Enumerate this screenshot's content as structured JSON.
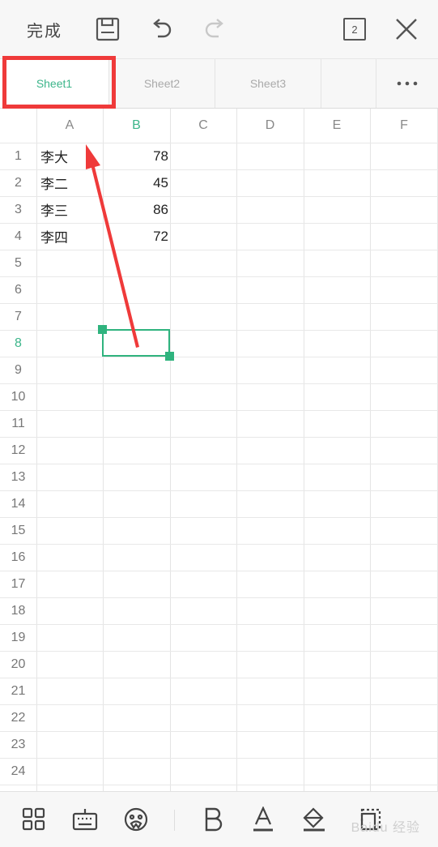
{
  "toolbar": {
    "done_label": "完成",
    "page_count": "2",
    "icons": [
      "save-icon",
      "undo-icon",
      "redo-icon",
      "page-count-icon",
      "close-icon"
    ]
  },
  "tabs": [
    {
      "label": "Sheet1",
      "active": true
    },
    {
      "label": "Sheet2",
      "active": false
    },
    {
      "label": "Sheet3",
      "active": false
    }
  ],
  "columns": [
    "A",
    "B",
    "C",
    "D",
    "E",
    "F"
  ],
  "selected_column": "B",
  "rows": [
    "1",
    "2",
    "3",
    "4",
    "5",
    "6",
    "7",
    "8",
    "9",
    "10",
    "11",
    "12",
    "13",
    "14",
    "15",
    "16",
    "17",
    "18",
    "19",
    "20",
    "21",
    "22",
    "23",
    "24"
  ],
  "selected_row": "8",
  "data_rows": [
    {
      "name": "李大",
      "value": "78"
    },
    {
      "name": "李二",
      "value": "45"
    },
    {
      "name": "李三",
      "value": "86"
    },
    {
      "name": "李四",
      "value": "72"
    }
  ],
  "bottom_icons": [
    "apps-icon",
    "keyboard-icon",
    "emoji-icon",
    "bold-icon",
    "text-color-icon",
    "fill-color-icon",
    "border-icon"
  ],
  "watermark": "Baidu 经验",
  "colors": {
    "accent": "#3cb58a",
    "highlight": "#ef3a3a"
  }
}
